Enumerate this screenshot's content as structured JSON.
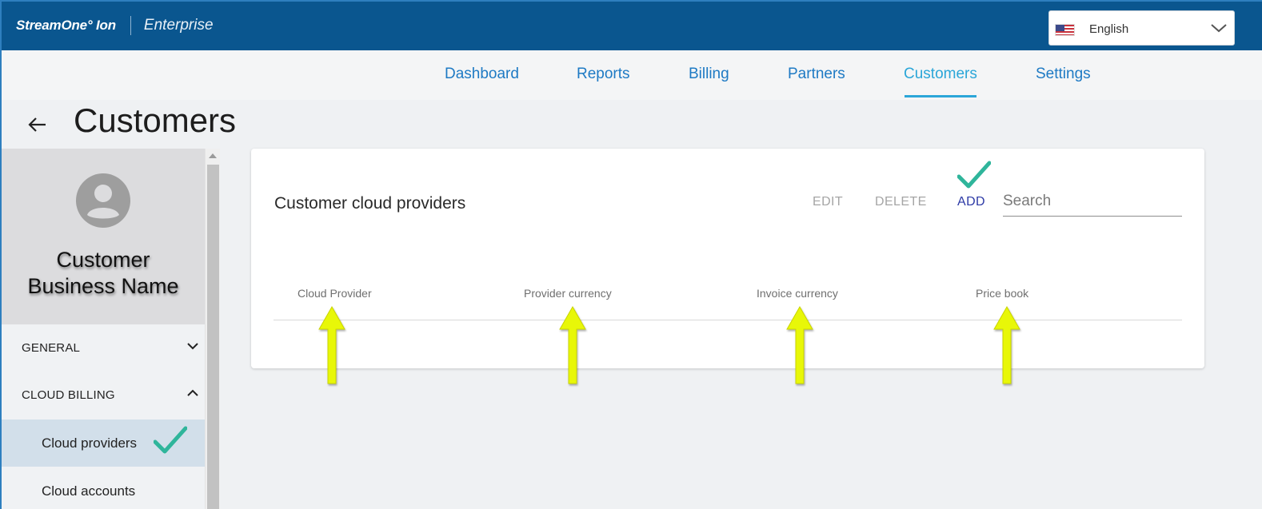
{
  "header": {
    "brand": "StreamOne° Ion",
    "product": "Enterprise",
    "language": {
      "selected": "English",
      "flag_icon": "us-flag-icon"
    }
  },
  "nav": {
    "items": [
      {
        "label": "Dashboard",
        "active": false
      },
      {
        "label": "Reports",
        "active": false
      },
      {
        "label": "Billing",
        "active": false
      },
      {
        "label": "Partners",
        "active": false
      },
      {
        "label": "Customers",
        "active": true
      },
      {
        "label": "Settings",
        "active": false
      }
    ]
  },
  "page": {
    "title": "Customers"
  },
  "sidebar": {
    "customer_name_line1": "Customer",
    "customer_name_line2": "Business Name",
    "sections": [
      {
        "label": "GENERAL",
        "expanded": false
      },
      {
        "label": "CLOUD BILLING",
        "expanded": true
      }
    ],
    "items": [
      {
        "label": "Cloud providers",
        "active": true
      },
      {
        "label": "Cloud accounts",
        "active": false
      }
    ]
  },
  "card": {
    "title": "Customer cloud providers",
    "actions": {
      "edit": "EDIT",
      "delete": "DELETE",
      "add": "ADD"
    },
    "search_placeholder": "Search",
    "columns": [
      "Cloud Provider",
      "Provider currency",
      "Invoice currency",
      "Price book"
    ]
  },
  "colors": {
    "topbar": "#0a568f",
    "nav_link": "#1e7ac4",
    "nav_active": "#2ba6d8",
    "check_annotation": "#2fb59b",
    "arrow_annotation": "#e8f708"
  }
}
